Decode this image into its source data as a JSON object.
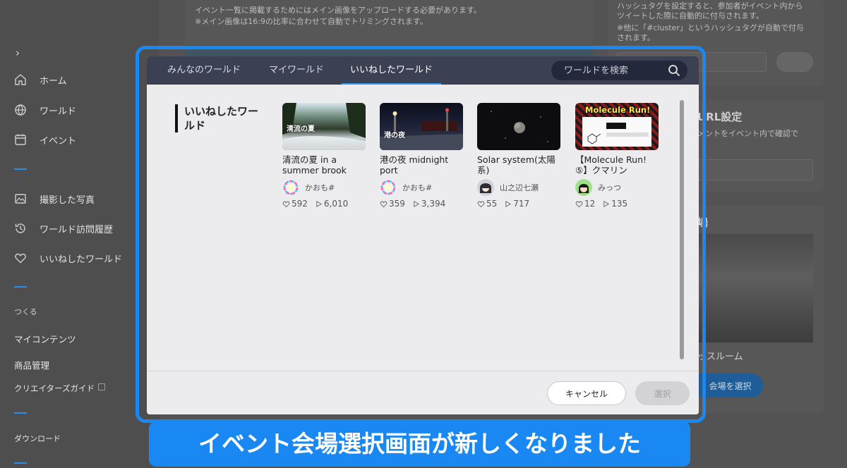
{
  "sidebar": {
    "items": [
      {
        "label": "ホーム",
        "icon": "home-icon"
      },
      {
        "label": "ワールド",
        "icon": "globe-icon"
      },
      {
        "label": "イベント",
        "icon": "calendar-icon"
      },
      {
        "label": "撮影した写真",
        "icon": "photo-icon"
      },
      {
        "label": "ワールド訪問履歴",
        "icon": "history-icon"
      },
      {
        "label": "いいねしたワールド",
        "icon": "heart-icon"
      }
    ],
    "create_caption": "つくる",
    "my_contents": "マイコンテンツ",
    "product_management": "商品管理",
    "creator_guide": "クリエイターズガイド",
    "download": "ダウンロード"
  },
  "background": {
    "note1": "イベント一覧に掲載するためにはメイン画像をアップロードする必要があります。",
    "note2": "※メイン画像は16:9の比率に合わせて自動でトリミングされます。",
    "right_note1": "ハッシュタグを設定すると、参加者がイベント内から",
    "right_note2": "ツイートした際に自動的に付与されます。",
    "right_note3": "※他に「#cluster」というハッシュタグが自動で付与",
    "right_note4": "されます。",
    "url_title": "URL設定",
    "url_note": "メントをイベント内で確認で",
    "venue_title": "場",
    "venue_name": "ッスルーム",
    "venue_button": "会場を選択"
  },
  "modal": {
    "tabs": [
      {
        "label": "みんなのワールド",
        "active": false
      },
      {
        "label": "マイワールド",
        "active": false
      },
      {
        "label": "いいねしたワールド",
        "active": true
      }
    ],
    "search_placeholder": "ワールドを検索",
    "section_title": "いいねしたワールド",
    "cards": [
      {
        "title": "清流の夏 in a summer brook",
        "thumb_label": "清流の夏",
        "author": "かおも#",
        "likes": "592",
        "plays": "6,010"
      },
      {
        "title": "港の夜 midnight port",
        "thumb_label": "港の夜",
        "author": "かおも#",
        "likes": "359",
        "plays": "3,394"
      },
      {
        "title": "Solar system(太陽系)",
        "thumb_label": "",
        "author": "山之辺七瀬",
        "likes": "55",
        "plays": "717"
      },
      {
        "title": "【Molecule Run!⑤】クマリン",
        "thumb_label": "Molecule Run!",
        "author": "みっつ",
        "likes": "12",
        "plays": "135"
      }
    ],
    "cancel_label": "キャンセル",
    "select_label": "選択"
  },
  "caption": "イベント会場選択画面が新しくなりました",
  "colors": {
    "accent": "#1a88f2",
    "header": "#3b4152",
    "tab_underline": "#2f9bf4"
  }
}
